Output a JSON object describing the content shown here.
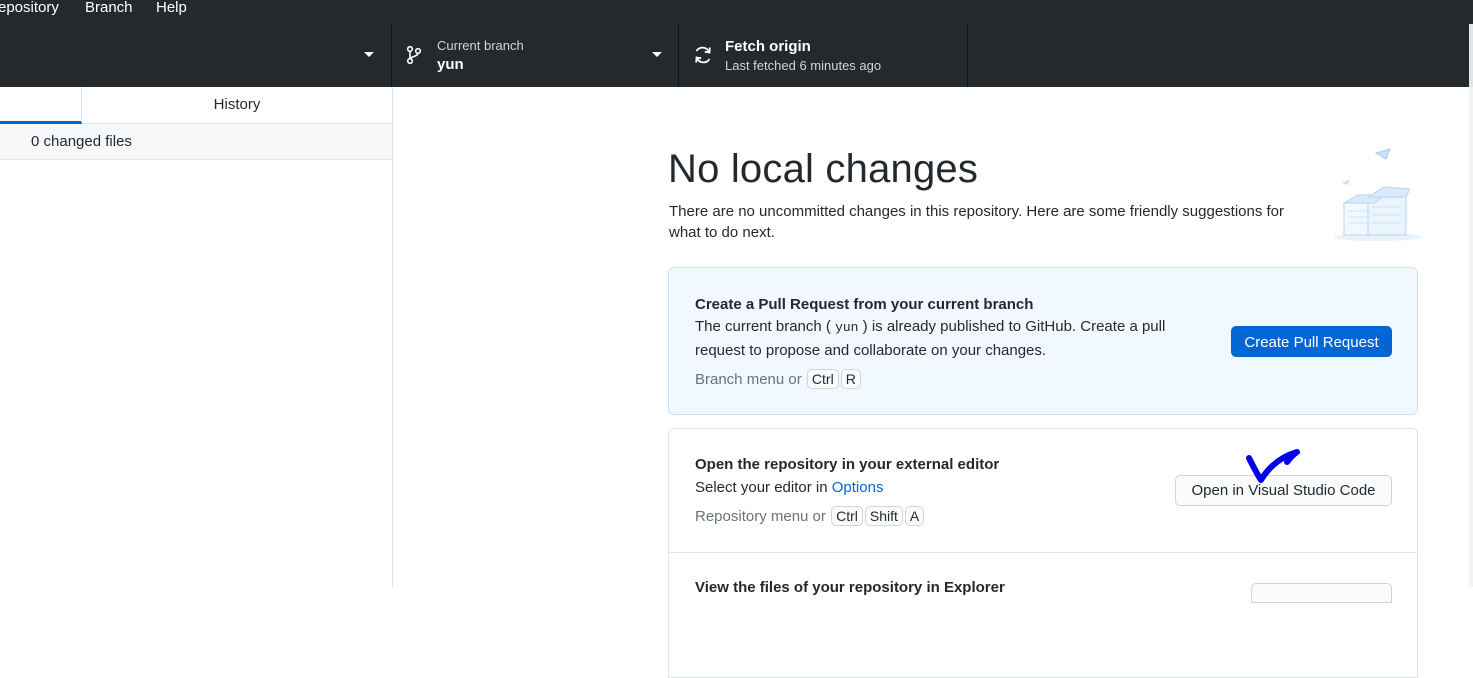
{
  "menu": {
    "items": [
      "epository",
      "Branch",
      "Help"
    ]
  },
  "toolbar": {
    "branch": {
      "label": "Current branch",
      "value": "yun",
      "icon": "git-branch-icon"
    },
    "fetch": {
      "label": "Fetch origin",
      "sub": "Last fetched 6 minutes ago",
      "icon": "sync-icon"
    }
  },
  "sidebar": {
    "tabs": [
      {
        "label": ""
      },
      {
        "label": "History"
      }
    ],
    "changed_files": "0 changed files"
  },
  "main": {
    "title": "No local changes",
    "description": "There are no uncommitted changes in this repository. Here are some friendly suggestions for what to do next.",
    "pull_request": {
      "title": "Create a Pull Request from your current branch",
      "text_before": "The current branch (",
      "branch": "yun",
      "text_after": ") is already published to GitHub. Create a pull request to propose and collaborate on your changes.",
      "hint": "Branch menu or",
      "keys": [
        "Ctrl",
        "R"
      ],
      "button": "Create Pull Request"
    },
    "editor": {
      "title": "Open the repository in your external editor",
      "text": "Select your editor in",
      "link": "Options",
      "hint": "Repository menu or",
      "keys": [
        "Ctrl",
        "Shift",
        "A"
      ],
      "button": "Open in Visual Studio Code"
    },
    "explorer": {
      "title": "View the files of your repository in Explorer"
    }
  },
  "colors": {
    "toolbar_bg": "#24292e",
    "accent": "#0366d6",
    "annotation": "#0000ee"
  }
}
